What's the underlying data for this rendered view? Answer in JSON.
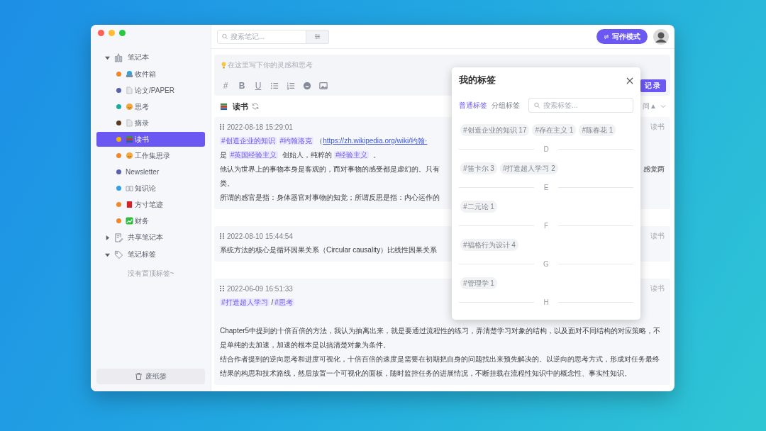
{
  "sidebar": {
    "sections": [
      {
        "label": "笔记本",
        "kind": "notebook",
        "expanded": true,
        "children": [
          {
            "name": "收件箱",
            "color": "#f0882b",
            "kind": "tray",
            "selected": false
          },
          {
            "name": "论文/PAPER",
            "color": "#5a5fb0",
            "kind": "page",
            "selected": false
          },
          {
            "name": "思考",
            "color": "#1aab9b",
            "kind": "smiley",
            "selected": false
          },
          {
            "name": "摘录",
            "color": "#5c3a21",
            "kind": "page",
            "selected": false
          },
          {
            "name": "读书",
            "color": "#f5b400",
            "kind": "books",
            "selected": true
          },
          {
            "name": "工作集思录",
            "color": "#f0882b",
            "kind": "smiley",
            "selected": false
          },
          {
            "name": "Newsletter",
            "color": "#5a5fb0",
            "kind": "none",
            "selected": false
          },
          {
            "name": "知识论",
            "color": "#2fa3e0",
            "kind": "openbook",
            "selected": false
          },
          {
            "name": "方寸笔迹",
            "color": "#f0882b",
            "kind": "redbook",
            "selected": false
          },
          {
            "name": "财务",
            "color": "#f0882b",
            "kind": "chart",
            "selected": false
          }
        ]
      },
      {
        "label": "共享笔记本",
        "kind": "shared",
        "expanded": false
      },
      {
        "label": "笔记标签",
        "kind": "tags",
        "expanded": true,
        "note": "没有置顶标签~"
      }
    ],
    "trash_button": "废纸篓"
  },
  "toolbar": {
    "search_placeholder": "搜索笔记...",
    "write_mode_button": "写作模式"
  },
  "editor": {
    "placeholder": "在这里写下你的灵感和思考",
    "tools": [
      {
        "kind": "hash",
        "label": "#"
      },
      {
        "kind": "bold",
        "label": "B"
      },
      {
        "kind": "underline",
        "label": "U"
      },
      {
        "kind": "bullets"
      },
      {
        "kind": "numbers"
      },
      {
        "kind": "emoji"
      },
      {
        "kind": "image"
      }
    ],
    "submit_button": "记录"
  },
  "notebook_header": {
    "title": "读书",
    "sort_label": "间▲"
  },
  "notes": [
    {
      "time": "2022-08-18 15:29:01",
      "notebook": "读书",
      "lines": [
        {
          "segments": [
            {
              "kind": "tag",
              "text": "#创造企业的知识"
            },
            {
              "kind": "tag",
              "text": "#约翰洛克"
            },
            {
              "kind": "plain",
              "text": "（"
            },
            {
              "kind": "link",
              "text": "https://zh.wikipedia.org/wiki/约翰·"
            }
          ]
        },
        {
          "segments": [
            {
              "kind": "plain",
              "text": "是 "
            },
            {
              "kind": "tag",
              "text": "#英国经验主义"
            },
            {
              "kind": "plain",
              "text": " 创始人，纯粹的 "
            },
            {
              "kind": "tag",
              "text": "#经验主义"
            },
            {
              "kind": "plain",
              "text": " 。"
            }
          ]
        },
        {
          "segments": [
            {
              "kind": "plain",
              "text": "他认为世界上的事物本身是客观的，而对事物的感受都是虚幻的。只有"
            }
          ],
          "right": "感觉两"
        },
        {
          "segments": [
            {
              "kind": "plain",
              "text": "类。"
            }
          ]
        },
        {
          "segments": [
            {
              "kind": "plain",
              "text": "所谓的感官是指：身体器官对事物的知觉；所谓反思是指：内心运作的"
            }
          ]
        }
      ]
    },
    {
      "time": "2022-08-10 15:44:54",
      "notebook": "读书",
      "lines": [
        {
          "segments": [
            {
              "kind": "plain",
              "text": "系统方法的核心是循环因果关系（Circular causality）比线性因果关系"
            }
          ]
        }
      ]
    },
    {
      "time": "2022-06-09 16:51:33",
      "notebook": "读书",
      "lines": [
        {
          "segments": [
            {
              "kind": "tag",
              "text": "#打造超人学习"
            },
            {
              "kind": "plain",
              "text": "/"
            },
            {
              "kind": "tag",
              "text": "#思考"
            }
          ]
        },
        {
          "gap_before": true,
          "segments": [
            {
              "kind": "plain",
              "text": "Chapter5中提到的十倍百倍的方法，我认为抽离出来，就是要通过流程性的练习，弄清楚学习对象的结构，以及面对不同结构的对应策略，不是单纯的去加速，加速的根本是以搞清楚对象为条件。"
            }
          ]
        },
        {
          "segments": [
            {
              "kind": "plain",
              "text": "结合作者提到的逆向思考和进度可视化，十倍百倍的速度是需要在初期把自身的问题找出来预先解决的。以逆向的思考方式，形成对任务最终结果的构思和技术路线，然后放置一个可视化的面板，随时监控任务的进展情况，不断挂载在流程性知识中的概念性、事实性知识。"
            }
          ]
        }
      ]
    }
  ],
  "tag_dialog": {
    "title": "我的标签",
    "tabs": [
      {
        "label": "普通标签",
        "selected": true
      },
      {
        "label": "分组标签",
        "selected": false
      }
    ],
    "search_placeholder": "搜索标签...",
    "groups": [
      {
        "tags": [
          "#创造企业的知识 17",
          "#存在主义 1",
          "#陈春花 1"
        ]
      },
      {
        "letter": "D",
        "tags": [
          "#笛卡尔 3",
          "#打造超人学习 2"
        ]
      },
      {
        "letter": "E",
        "tags": [
          "#二元论 1"
        ]
      },
      {
        "letter": "F",
        "tags": [
          "#福格行为设计 4"
        ]
      },
      {
        "letter": "G",
        "tags": [
          "#管理学 1"
        ]
      },
      {
        "letter": "H"
      }
    ]
  }
}
